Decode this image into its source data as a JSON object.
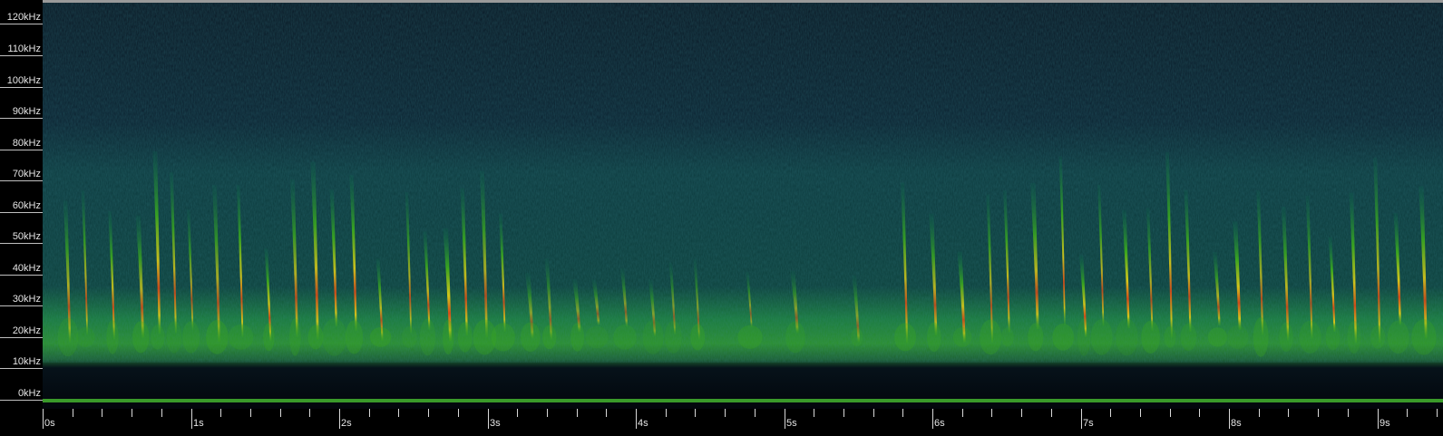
{
  "frequency_axis": {
    "labels": [
      "120kHz",
      "110kHz",
      "100kHz",
      "90kHz",
      "80kHz",
      "70kHz",
      "60kHz",
      "50kHz",
      "40kHz",
      "30kHz",
      "20kHz",
      "10kHz",
      "0kHz"
    ],
    "values_khz": [
      120,
      110,
      100,
      90,
      80,
      70,
      60,
      50,
      40,
      30,
      20,
      10,
      0
    ],
    "max_khz": 125
  },
  "time_axis": {
    "labels": [
      "0s",
      "1s",
      "2s",
      "3s",
      "4s",
      "5s",
      "6s",
      "7s",
      "8s",
      "9s"
    ],
    "values_s": [
      0,
      1,
      2,
      3,
      4,
      5,
      6,
      7,
      8,
      9
    ],
    "duration_s": 9.45,
    "minor_ticks_per_second": 5
  },
  "colors": {
    "background": "#000000",
    "noise": "#0b2a33",
    "signal_low": "#0b6d4e",
    "signal_mid": "#3aa81e",
    "signal_high": "#d8c81a",
    "signal_peak": "#d84a18",
    "baseline": "#3a9a2a"
  }
}
